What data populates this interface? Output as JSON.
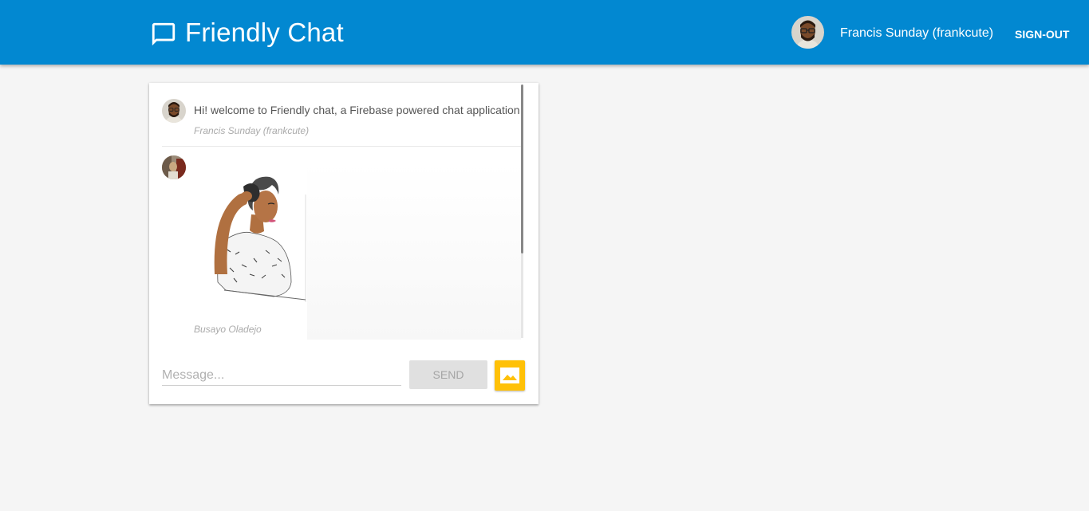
{
  "header": {
    "app_title": "Friendly Chat",
    "user_name": "Francis Sunday (frankcute)",
    "sign_out_label": "SIGN-OUT",
    "logo_icon": "chat-bubble-icon",
    "background_color": "#0288d1"
  },
  "messages": [
    {
      "text": "Hi! welcome to Friendly chat, a Firebase powered chat application",
      "author": "Francis Sunday (frankcute)"
    },
    {
      "image": "woman-illustration",
      "author": "Busayo Oladejo"
    }
  ],
  "composer": {
    "placeholder": "Message...",
    "send_label": "SEND",
    "image_icon": "image-icon",
    "image_button_color": "#ffc107"
  }
}
